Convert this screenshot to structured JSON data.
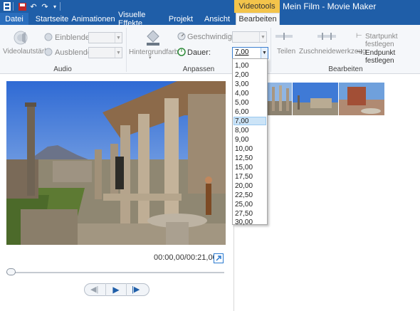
{
  "window": {
    "title": "Mein Film - Movie Maker",
    "context_tab_header": "Videotools"
  },
  "tabs": [
    {
      "label": "Datei"
    },
    {
      "label": "Startseite"
    },
    {
      "label": "Animationen"
    },
    {
      "label": "Visuelle Effekte"
    },
    {
      "label": "Projekt"
    },
    {
      "label": "Ansicht"
    },
    {
      "label": "Bearbeiten"
    }
  ],
  "ribbon": {
    "audio": {
      "group_label": "Audio",
      "volume_label": "Videolautstärke",
      "fade_in_label": "Einblenden:",
      "fade_out_label": "Ausblenden:"
    },
    "adjust": {
      "group_label": "Anpassen",
      "background_color_label": "Hintergrundfarbe",
      "speed_label": "Geschwindigkeit:",
      "duration_label": "Dauer:",
      "duration_value": "7,00"
    },
    "edit": {
      "group_label": "Bearbeiten",
      "split_label": "Teilen",
      "trim_label": "Zuschneidewerkzeug",
      "set_start_label": "Startpunkt festlegen",
      "set_end_label": "Endpunkt festlegen"
    }
  },
  "duration_options": [
    "1,00",
    "2,00",
    "3,00",
    "4,00",
    "5,00",
    "6,00",
    "7,00",
    "8,00",
    "9,00",
    "10,00",
    "12,50",
    "15,00",
    "17,50",
    "20,00",
    "22,50",
    "25,00",
    "27,50",
    "30,00"
  ],
  "duration_selected_index": 6,
  "player": {
    "time_display": "00:00,00/00:21,00",
    "seek_fraction": 0
  },
  "colors": {
    "titlebar": "#1f5ea8",
    "context_tab": "#f3c44b",
    "dropdown_highlight": "#cce4f7"
  }
}
